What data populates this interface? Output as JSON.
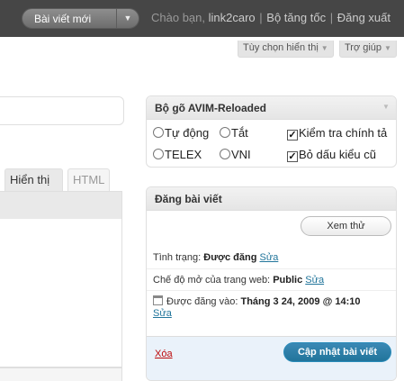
{
  "topbar": {
    "new_post_label": "Bài viết mới",
    "greeting_prefix": "Chào bạn,",
    "username": "link2caro",
    "separator": "|",
    "dashboard_link": "Bộ tăng tốc",
    "logout_link": "Đăng xuất"
  },
  "subbar": {
    "screen_options": "Tùy chọn hiển thị",
    "help": "Trợ giúp"
  },
  "editor": {
    "tab_visual": "Hiển thị",
    "tab_html": "HTML"
  },
  "avim": {
    "title": "Bộ gõ AVIM-Reloaded",
    "options": {
      "auto": "Tự động",
      "off": "Tắt",
      "telex": "TELEX",
      "vni": "VNI",
      "spellcheck": "Kiểm tra chính tả",
      "old_accent": "Bỏ dấu kiểu cũ"
    },
    "check_mark": "✓"
  },
  "publish": {
    "title": "Đăng bài viết",
    "preview_button": "Xem thử",
    "status_label": "Tình trạng:",
    "status_value": "Được đăng",
    "edit_link": "Sửa",
    "visibility_label": "Chế độ mở của trang web:",
    "visibility_value": "Public",
    "published_label": "Được đăng vào:",
    "published_value": "Tháng 3 24, 2009 @ 14:10",
    "delete_link": "Xóa",
    "update_button": "Cập nhật bài viết"
  },
  "icons": {
    "dropdown": "chevron-down-icon",
    "calendar": "calendar-icon"
  },
  "colors": {
    "topbar_bg": "#464646",
    "link": "#21759b",
    "update_button": "#21759b",
    "delete": "#bc0b0b",
    "publish_footer": "#eaf2fa"
  }
}
